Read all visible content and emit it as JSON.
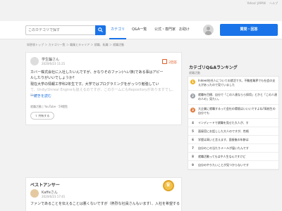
{
  "top_links": [
    "Yahoo! JAPAN",
    "ヘルプ"
  ],
  "header": {
    "search_placeholder": "このカテゴリで探す",
    "nav": [
      "カテゴリ",
      "Q&A一覧",
      "公式・専門家",
      "お助け"
    ],
    "login_label": "質問・回答"
  },
  "breadcrumb": "知恵袋トップ ＞ カテゴリ一覧 ＞ 職業とキャリア ＞ 就職、転職 ＞ 就職活動",
  "question": {
    "user": "学生騙さん",
    "date": "2020/6/23 11:21",
    "badge": "2回答",
    "body_lines": [
      "カバー株式会社に入社したいんですが、かなりそのファン(へい族)である事はアピー",
      "ルしたりがいいでしょうか?",
      "現在大学の情報工学科2年生です。大学ではプログラミングをがっつり勉強してい",
      "て、Unity/Unreal Engineも扱えるのですが、このホームにもRepositoryがありますでし、Start"
    ],
    "more": "一続きを読む",
    "meta": "就職活動 | YouTube · 59閲覧",
    "share": "共有する"
  },
  "best_answer": {
    "title": "ベストアンサー",
    "user": "Kaffeさん",
    "date": "2020/6/23 17:41",
    "body": "ファンであることを伝えることは悪くないですが（熱烈な社員さんもいます）、入社を希望する"
  },
  "sidebar": {
    "title": "カテゴリQ&Aランキング",
    "subtitle": "就職活動",
    "items": [
      {
        "rank": "1",
        "color": "#f0b429",
        "text": "Indeed在任人についての就活です。不動産業界でも社会の支えがあったので見ていました"
      },
      {
        "rank": "2",
        "color": "#9aa0a6",
        "text": "就職を目標、自分で「この人達ならら採用」とかと「この人達の人の」見たい。"
      },
      {
        "rank": "3",
        "color": "#e07a3e",
        "text": "大企業に就職するって会社の環境はいいいですよね?高校生の自分でも"
      },
      {
        "rank": "4",
        "color": "",
        "text": "インディードで就職を見せた大人が、す"
      },
      {
        "rank": "5",
        "color": "",
        "text": "面接官にお話しした大人のですが、性格"
      },
      {
        "rank": "6",
        "color": "",
        "text": "学歴は高いと言えます、面接後の年齢は"
      },
      {
        "rank": "7",
        "color": "",
        "text": "自分のこの当たりメールが届いたんです"
      },
      {
        "rank": "8",
        "color": "",
        "text": "就職活動ってもはや人生なんですけど"
      },
      {
        "rank": "9",
        "color": "",
        "text": "自分のやりたいことが見つからないです"
      }
    ]
  }
}
